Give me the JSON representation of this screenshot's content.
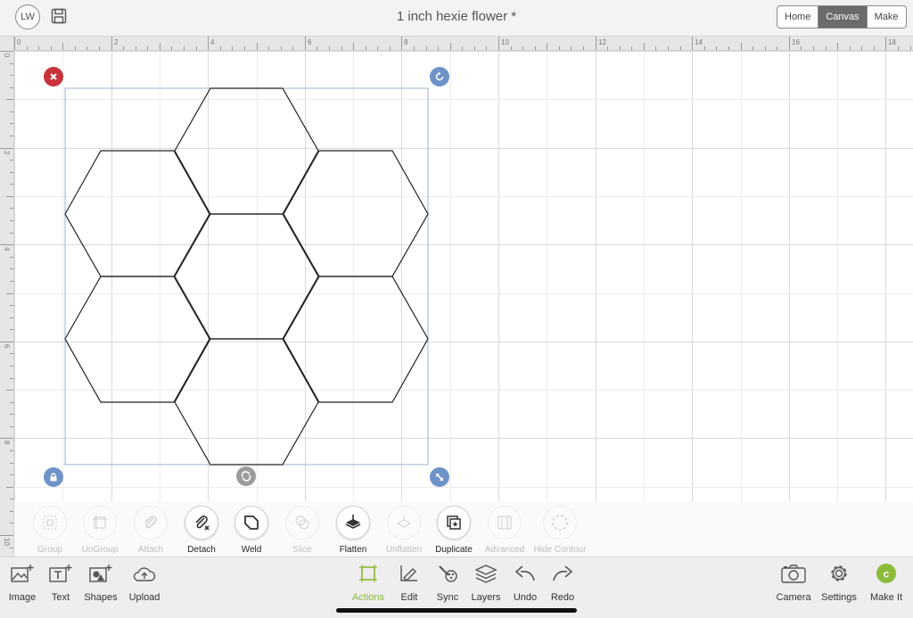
{
  "header": {
    "avatar_initials": "LW",
    "document_title": "1 inch hexie flower *",
    "view_tabs": [
      {
        "label": "Home",
        "active": false
      },
      {
        "label": "Canvas",
        "active": true
      },
      {
        "label": "Make",
        "active": false
      }
    ]
  },
  "rulers": {
    "top_labels": [
      "0",
      "2",
      "4",
      "6",
      "8",
      "10",
      "12",
      "14",
      "16",
      "18"
    ],
    "left_labels": [
      "0",
      "2",
      "4",
      "6",
      "8",
      "10"
    ]
  },
  "actions": [
    {
      "label": "Group",
      "enabled": false,
      "icon": "group-icon"
    },
    {
      "label": "UnGroup",
      "enabled": false,
      "icon": "ungroup-icon"
    },
    {
      "label": "Attach",
      "enabled": false,
      "icon": "paperclip-icon"
    },
    {
      "label": "Detach",
      "enabled": true,
      "icon": "detach-icon"
    },
    {
      "label": "Weld",
      "enabled": true,
      "icon": "weld-icon"
    },
    {
      "label": "Slice",
      "enabled": false,
      "icon": "slice-icon"
    },
    {
      "label": "Flatten",
      "enabled": true,
      "icon": "flatten-icon"
    },
    {
      "label": "Unflatten",
      "enabled": false,
      "icon": "unflatten-icon"
    },
    {
      "label": "Duplicate",
      "enabled": true,
      "icon": "duplicate-icon"
    },
    {
      "label": "Advanced",
      "enabled": false,
      "icon": "advanced-icon"
    },
    {
      "label": "Hide Contour",
      "enabled": false,
      "icon": "hide-contour-icon"
    }
  ],
  "toolbar_left": [
    {
      "label": "Image",
      "icon": "image-add-icon"
    },
    {
      "label": "Text",
      "icon": "text-add-icon"
    },
    {
      "label": "Shapes",
      "icon": "shapes-add-icon"
    },
    {
      "label": "Upload",
      "icon": "upload-cloud-icon"
    }
  ],
  "toolbar_center": [
    {
      "label": "Actions",
      "icon": "actions-icon",
      "active": true
    },
    {
      "label": "Edit",
      "icon": "edit-icon",
      "active": false
    },
    {
      "label": "Sync",
      "icon": "sync-icon",
      "active": false
    },
    {
      "label": "Layers",
      "icon": "layers-icon",
      "active": false
    },
    {
      "label": "Undo",
      "icon": "undo-icon",
      "active": false
    },
    {
      "label": "Redo",
      "icon": "redo-icon",
      "active": false
    }
  ],
  "toolbar_right": [
    {
      "label": "Camera",
      "icon": "camera-icon"
    },
    {
      "label": "Settings",
      "icon": "gear-icon"
    },
    {
      "label": "Make It",
      "icon": "make-it-icon"
    }
  ],
  "colors": {
    "accent_green": "#8dbb3a",
    "delete_red": "#c8333a",
    "handle_blue": "#6d93c9",
    "selection_border": "#9fb3cc"
  }
}
